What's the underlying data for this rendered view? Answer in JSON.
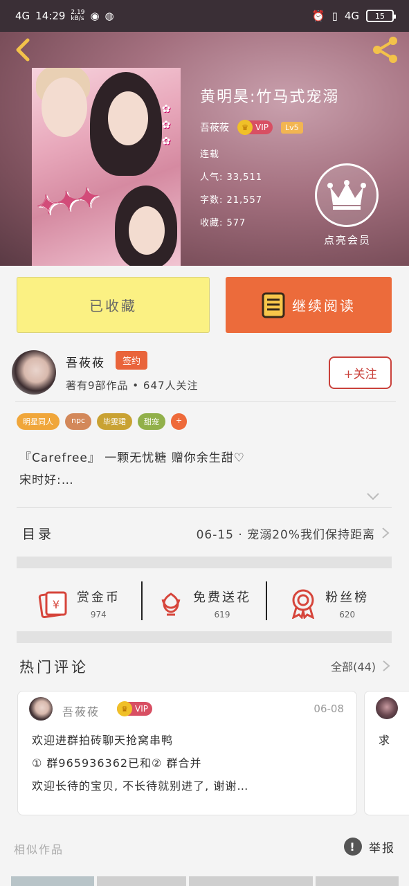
{
  "status_bar": {
    "signal": "4G",
    "time": "14:29",
    "speed_top": "2.19",
    "speed_bottom": "kB/s",
    "signal_right": "4G",
    "battery": "15"
  },
  "book": {
    "title": "黄明昊:竹马式宠溺",
    "author": "吾莜莜",
    "vip_label": "VIP",
    "level": "Lv5",
    "status": "连载",
    "popularity": "人气: 33,511",
    "word_count": "字数: 21,557",
    "favorites": "收藏: 577",
    "member_label": "点亮会员"
  },
  "actions": {
    "collected": "已收藏",
    "continue_reading": "继续阅读"
  },
  "author": {
    "name": "吾莜莜",
    "badge": "签约",
    "meta": "著有9部作品 • 647人关注",
    "follow": "+关注"
  },
  "tags": [
    {
      "label": "明星同人",
      "color": "#f0a63a"
    },
    {
      "label": "npc",
      "color": "#d3885a"
    },
    {
      "label": "毕雯珺",
      "color": "#c9a233"
    },
    {
      "label": "甜宠",
      "color": "#91b04a"
    },
    {
      "label": "+",
      "color": "#ee6a3a"
    }
  ],
  "intro": {
    "line1": "『Carefree』 一颗无忧糖  赠你余生甜♡",
    "line2": "宋时好:…"
  },
  "toc": {
    "label": "目录",
    "latest": "06-15 · 宠溺20%我们保持距离"
  },
  "stats": [
    {
      "label": "赏金币",
      "value": "974",
      "icon": "red-envelope-icon"
    },
    {
      "label": "免费送花",
      "value": "619",
      "icon": "flower-icon"
    },
    {
      "label": "粉丝榜",
      "value": "620",
      "icon": "medal-icon"
    }
  ],
  "comments": {
    "title": "热门评论",
    "all": "全部(44)",
    "card1": {
      "name": "吾莜莜",
      "vip": "VIP",
      "date": "06-08",
      "line1": "欢迎进群拍砖聊天抢窝串鸭",
      "line2": "① 群965936362已和② 群合并",
      "line3": "欢迎长待的宝贝, 不长待就别进了, 谢谢…"
    },
    "card2": {
      "text": "求"
    }
  },
  "footer": {
    "similar": "相似作品",
    "report": "举报"
  },
  "colors": {
    "accent_orange": "#ec6b3b",
    "collected_yellow": "#fbf183",
    "follow_red": "#c9403a"
  }
}
